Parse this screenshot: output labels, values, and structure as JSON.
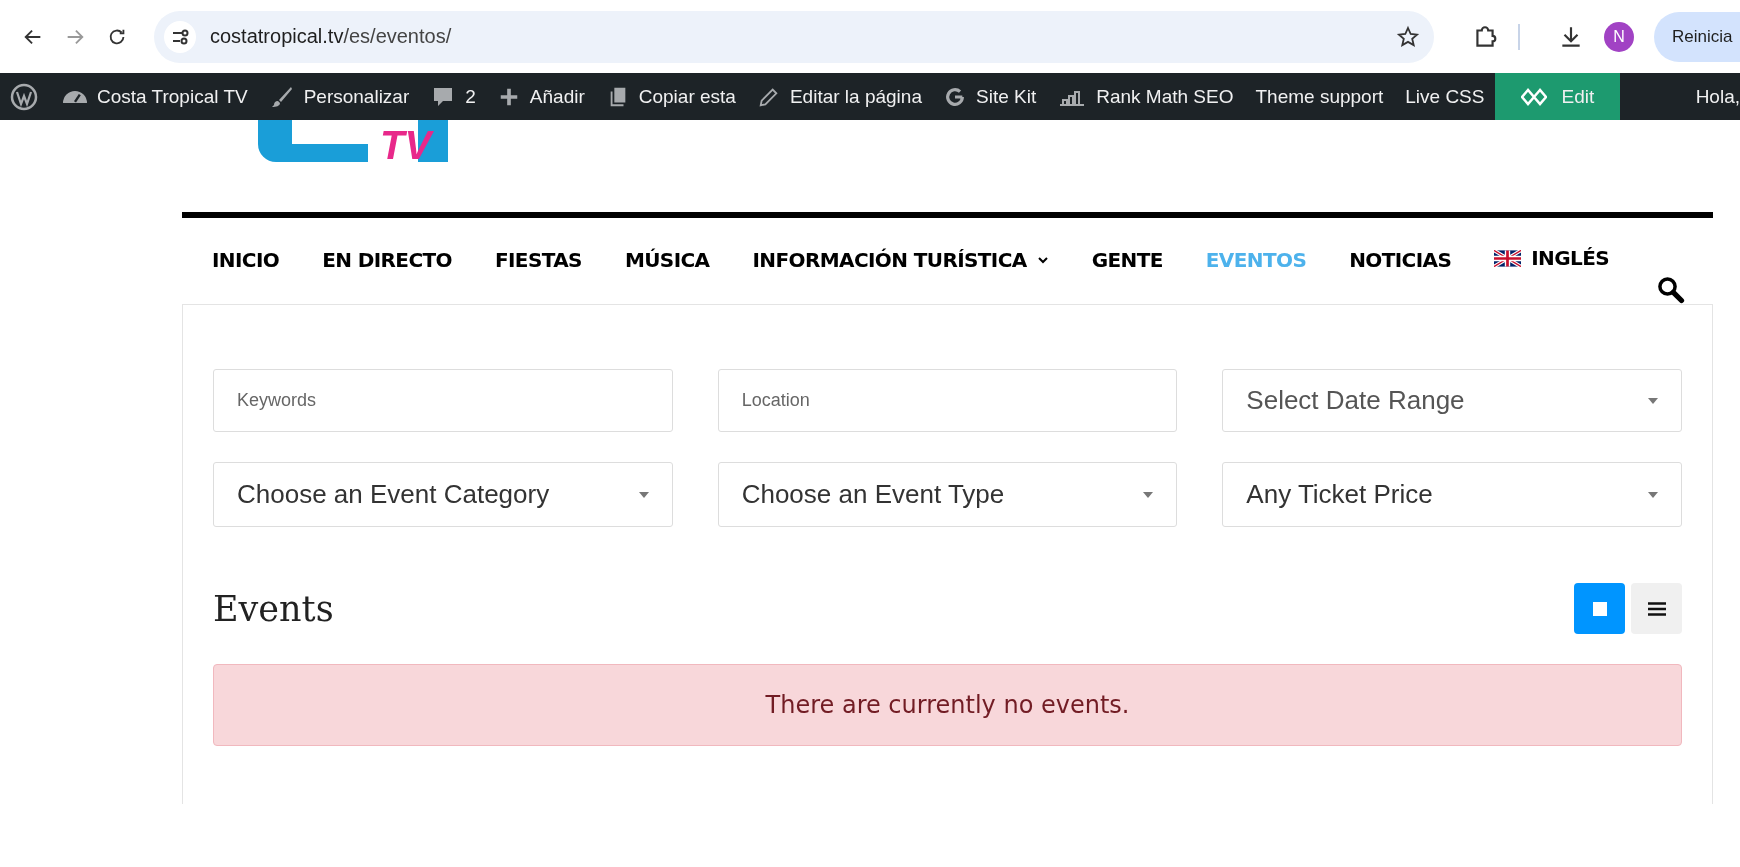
{
  "browser": {
    "url_host": "costatropical.tv",
    "url_path": "/es/eventos/",
    "profile_initial": "N",
    "restart_button": "Reinicia"
  },
  "admin_bar": {
    "items": [
      {
        "kind": "wp"
      },
      {
        "kind": "site",
        "label": "Costa Tropical TV"
      },
      {
        "kind": "brush",
        "label": "Personalizar"
      },
      {
        "kind": "comment",
        "label": "2"
      },
      {
        "kind": "plus",
        "label": "Añadir"
      },
      {
        "kind": "copy",
        "label": "Copiar esta"
      },
      {
        "kind": "pencil",
        "label": "Editar la página"
      },
      {
        "kind": "google",
        "label": "Site Kit"
      },
      {
        "kind": "chart",
        "label": "Rank Math SEO"
      },
      {
        "kind": "text",
        "label": "Theme support"
      },
      {
        "kind": "text",
        "label": "Live CSS"
      },
      {
        "kind": "edit",
        "label": "Edit"
      }
    ],
    "greeting": "Hola,"
  },
  "logo": {
    "text": "TV"
  },
  "nav": {
    "items": [
      {
        "label": "INICIO",
        "selected": false,
        "dropdown": false
      },
      {
        "label": "EN DIRECTO",
        "selected": false,
        "dropdown": false
      },
      {
        "label": "FIESTAS",
        "selected": false,
        "dropdown": false
      },
      {
        "label": "MÚSICA",
        "selected": false,
        "dropdown": false
      },
      {
        "label": "INFORMACIÓN TURÍSTICA",
        "selected": false,
        "dropdown": true
      },
      {
        "label": "GENTE",
        "selected": false,
        "dropdown": false
      },
      {
        "label": "EVENTOS",
        "selected": true,
        "dropdown": false
      },
      {
        "label": "NOTICIAS",
        "selected": false,
        "dropdown": false
      }
    ],
    "language": "INGLÉS"
  },
  "filters": [
    {
      "kind": "input",
      "placeholder": "Keywords"
    },
    {
      "kind": "input",
      "placeholder": "Location"
    },
    {
      "kind": "select",
      "value": "Select Date Range"
    },
    {
      "kind": "select",
      "value": "Choose an Event Category"
    },
    {
      "kind": "select",
      "value": "Choose an Event Type"
    },
    {
      "kind": "select",
      "value": "Any Ticket Price"
    }
  ],
  "events": {
    "heading": "Events",
    "views": [
      {
        "kind": "grid",
        "selected": true
      },
      {
        "kind": "list",
        "selected": false
      }
    ],
    "message": "There are currently no events."
  }
}
